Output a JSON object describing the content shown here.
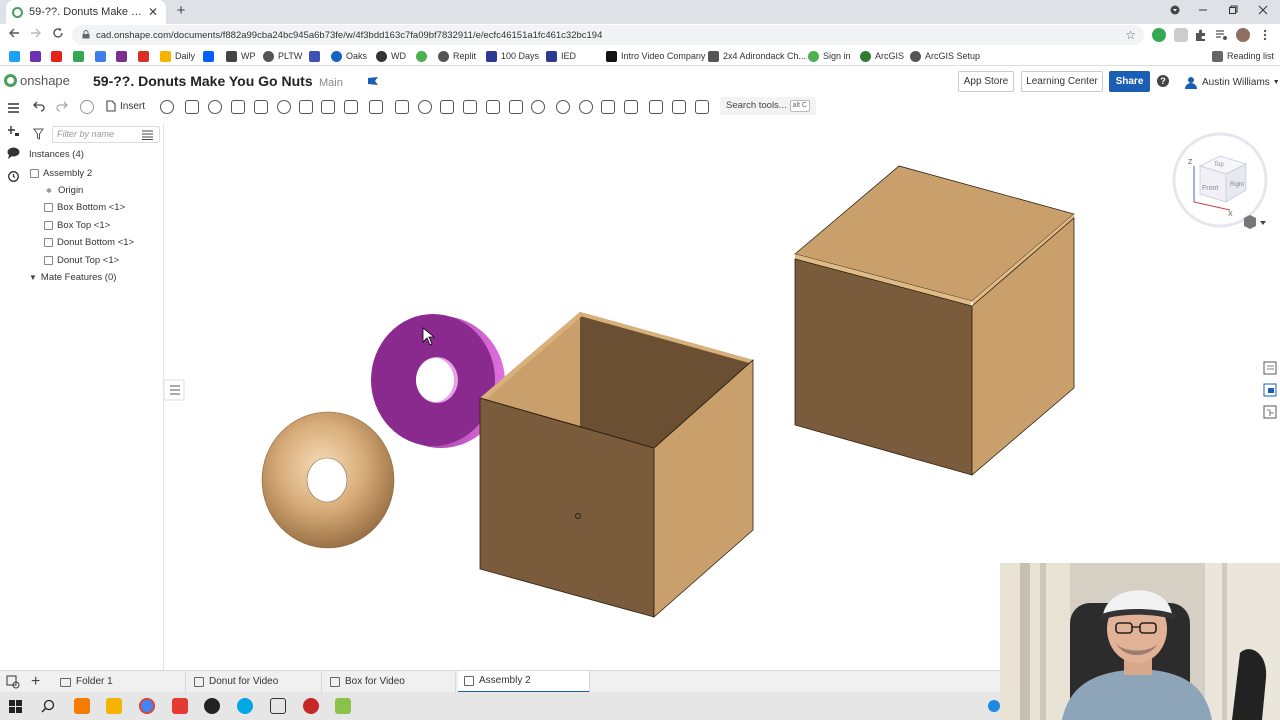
{
  "browser": {
    "tab_title": "59-??. Donuts Make You Go Nuts",
    "tab_close": "✕",
    "new_tab": "+",
    "url": "cad.onshape.com/documents/f882a99cba24bc945a6b73fe/w/4f3bdd163c7fa09bf7832911/e/ecfc46151a1fc461c32bc194"
  },
  "bookmarks": [
    {
      "label": "",
      "color": "#1da1f2"
    },
    {
      "label": "",
      "color": "#6d2fb3"
    },
    {
      "label": "",
      "color": "#e62117"
    },
    {
      "label": "",
      "color": "#34a853"
    },
    {
      "label": "",
      "color": "#3f7ee8"
    },
    {
      "label": "",
      "color": "#7b2f8e"
    },
    {
      "label": "",
      "color": "#d93025"
    },
    {
      "label": "Daily",
      "color": "#f4b400"
    },
    {
      "label": "",
      "color": "#0061ff"
    },
    {
      "label": "WP",
      "color": "#444444"
    },
    {
      "label": "PLTW",
      "color": "#555555"
    },
    {
      "label": "",
      "color": "#3f51b5"
    },
    {
      "label": "Oaks",
      "color": "#1565c0"
    },
    {
      "label": "WD",
      "color": "#333333"
    },
    {
      "label": "",
      "color": "#4caf50"
    },
    {
      "label": "Replit",
      "color": "#555555"
    },
    {
      "label": "100 Days",
      "color": "#2b3990"
    },
    {
      "label": "IED",
      "color": "#2b3990"
    },
    {
      "label": "Intro Video Company",
      "color": "#111111"
    },
    {
      "label": "2x4 Adirondack Ch...",
      "color": "#555555"
    },
    {
      "label": "Sign in",
      "color": "#4caf50"
    },
    {
      "label": "ArcGIS",
      "color": "#2e7d32"
    },
    {
      "label": "ArcGIS Setup",
      "color": "#555555"
    },
    {
      "label": "Reading list",
      "color": "#666666"
    }
  ],
  "onshape": {
    "logo_text": "onshape",
    "document_title": "59-??. Donuts Make You Go Nuts",
    "workspace": "Main",
    "app_store": "App Store",
    "learning_center": "Learning Center",
    "share": "Share",
    "help_icon": "?",
    "user_name": "Austin Williams"
  },
  "toolbar": {
    "insert_label": "Insert",
    "search_placeholder": "Search tools...",
    "search_shortcut": "alt C"
  },
  "panel": {
    "filter_placeholder": "Filter by name",
    "instances_header": "Instances (4)",
    "assembly": "Assembly 2",
    "items": [
      {
        "label": "Origin"
      },
      {
        "label": "Box Bottom <1>"
      },
      {
        "label": "Box Top <1>"
      },
      {
        "label": "Donut Bottom <1>"
      },
      {
        "label": "Donut Top <1>"
      }
    ],
    "mate_features": "Mate Features (0)"
  },
  "viewcube": {
    "top": "Top",
    "front": "Front",
    "right": "Right",
    "z_axis": "Z",
    "x_axis": "X"
  },
  "bottom_tabs": [
    {
      "label": "Folder 1",
      "active": false
    },
    {
      "label": "Donut for Video",
      "active": false
    },
    {
      "label": "Box for Video",
      "active": false
    },
    {
      "label": "Assembly 2",
      "active": true
    }
  ],
  "colors": {
    "wood": "#c9a06c",
    "wood_dark": "#7a5c3c",
    "donut_purple": "#8b2a8e",
    "accent": "#1a5fb4",
    "onshape_green": "#4a9e5c"
  }
}
